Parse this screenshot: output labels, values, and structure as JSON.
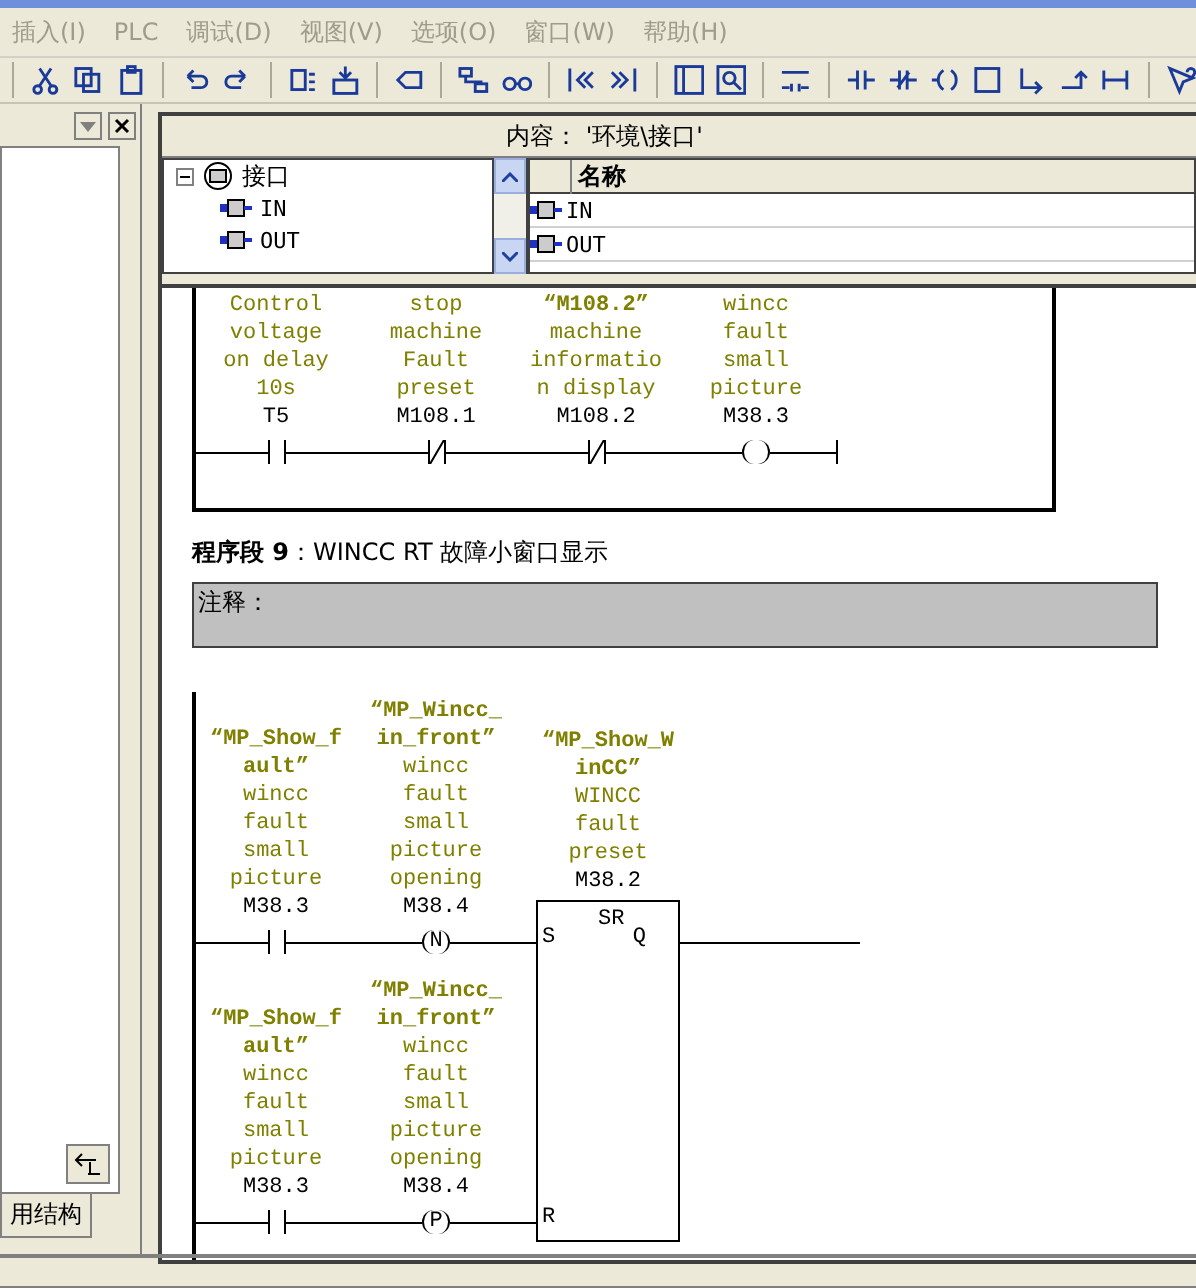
{
  "menu": [
    "插入(I)",
    "PLC",
    "调试(D)",
    "视图(V)",
    "选项(O)",
    "窗口(W)",
    "帮助(H)"
  ],
  "left_panel": {
    "tab": "用结构"
  },
  "interface": {
    "content_label": "内容：",
    "content_path": "'环境\\接口'",
    "tree": {
      "label": "接口",
      "expanded": true,
      "children": [
        {
          "label": "IN"
        },
        {
          "label": "OUT"
        }
      ]
    },
    "table": {
      "column": "名称",
      "rows": [
        "IN",
        "OUT"
      ]
    }
  },
  "networks": [
    {
      "rungs": [
        {
          "elements": [
            {
              "kind": "no_contact",
              "comment": [
                "Control",
                "voltage",
                "on delay",
                "10s"
              ],
              "address": "T5"
            },
            {
              "kind": "nc_contact",
              "comment": [
                "stop",
                "machine",
                "Fault",
                "preset"
              ],
              "address": "M108.1"
            },
            {
              "kind": "nc_contact",
              "symbol": [
                "“M108.2”"
              ],
              "comment": [
                "machine",
                "informatio",
                "n display"
              ],
              "address": "M108.2"
            },
            {
              "kind": "coil",
              "comment": [
                "wincc",
                "fault",
                "small",
                "picture"
              ],
              "address": "M38.3"
            }
          ]
        }
      ]
    },
    {
      "title": "**程序段 9**：WINCC RT 故障小窗口显示",
      "comment_label": "注释：",
      "rungs": [
        {
          "elements": [
            {
              "kind": "no_contact",
              "symbol": [
                "“MP_Show_f",
                "ault”"
              ],
              "comment": [
                "wincc",
                "fault",
                "small",
                "picture"
              ],
              "address": "M38.3"
            },
            {
              "kind": "edge",
              "mark": "N",
              "symbol": [
                "“MP_Wincc_",
                "in_front”"
              ],
              "comment": [
                "wincc",
                "fault",
                "small",
                "picture",
                "opening"
              ],
              "address": "M38.4"
            }
          ]
        },
        {
          "elements": [
            {
              "kind": "no_contact",
              "symbol": [
                "“MP_Show_f",
                "ault”"
              ],
              "comment": [
                "wincc",
                "fault",
                "small",
                "picture"
              ],
              "address": "M38.3"
            },
            {
              "kind": "edge",
              "mark": "P",
              "symbol": [
                "“MP_Wincc_",
                "in_front”"
              ],
              "comment": [
                "wincc",
                "fault",
                "small",
                "picture",
                "opening"
              ],
              "address": "M38.4"
            }
          ]
        }
      ],
      "box": {
        "type": "SR",
        "symbol": [
          "“MP_Show_W",
          "inCC”"
        ],
        "comment": [
          "WINCC",
          "fault",
          "preset"
        ],
        "address": "M38.2",
        "inputs": [
          "S",
          "R"
        ],
        "output": "Q"
      }
    }
  ]
}
